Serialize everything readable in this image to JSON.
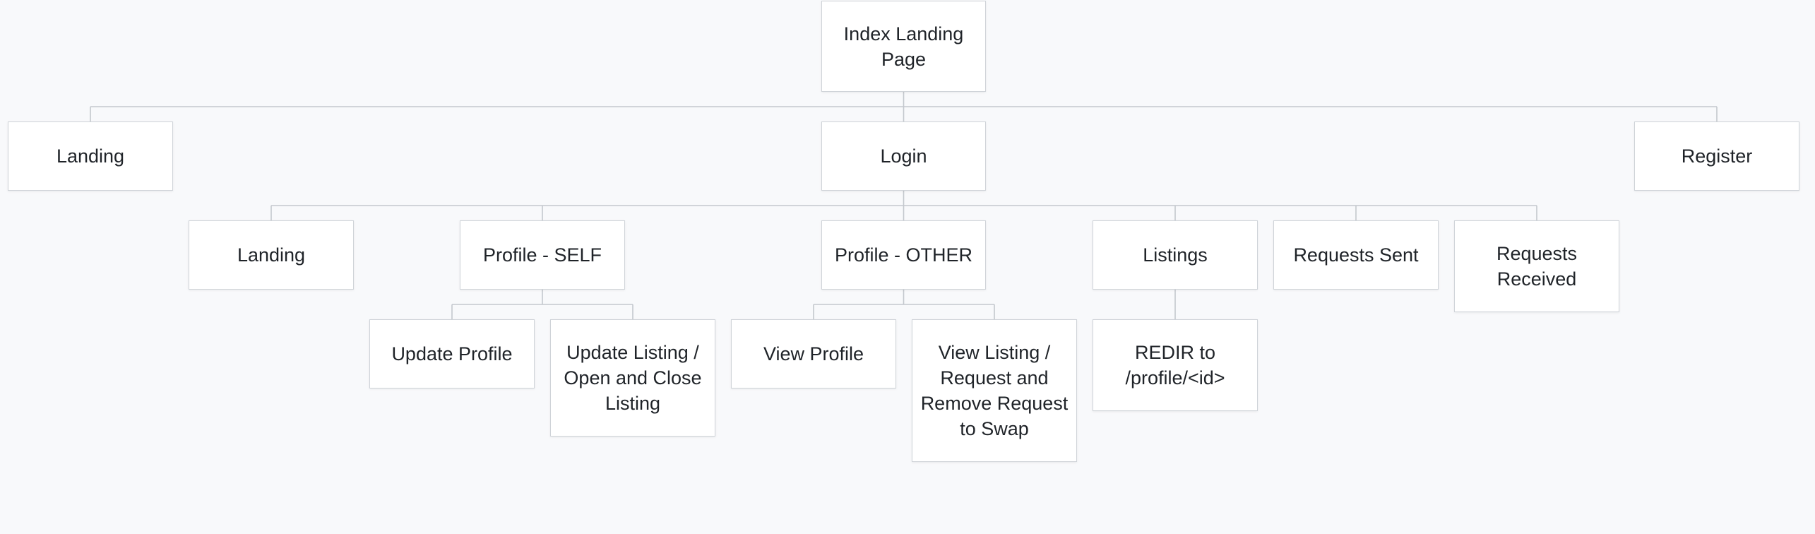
{
  "diagram": {
    "nodes": {
      "index": "Index Landing\nPage",
      "landing_top": "Landing",
      "login": "Login",
      "register": "Register",
      "landing_sub": "Landing",
      "profile_self": "Profile - SELF",
      "profile_other": "Profile - OTHER",
      "listings": "Listings",
      "requests_sent": "Requests Sent",
      "requests_received": "Requests\nReceived",
      "update_profile": "Update Profile",
      "update_listing": "Update Listing  /\nOpen and Close\nListing",
      "view_profile": "View Profile",
      "view_listing": "View Listing /\nRequest and\nRemove Request\nto Swap",
      "redir": "REDIR to\n/profile/<id>"
    },
    "edges": [
      [
        "index",
        "landing_top"
      ],
      [
        "index",
        "login"
      ],
      [
        "index",
        "register"
      ],
      [
        "login",
        "landing_sub"
      ],
      [
        "login",
        "profile_self"
      ],
      [
        "login",
        "profile_other"
      ],
      [
        "login",
        "listings"
      ],
      [
        "login",
        "requests_sent"
      ],
      [
        "login",
        "requests_received"
      ],
      [
        "profile_self",
        "update_profile"
      ],
      [
        "profile_self",
        "update_listing"
      ],
      [
        "profile_other",
        "view_profile"
      ],
      [
        "profile_other",
        "view_listing"
      ],
      [
        "listings",
        "redir"
      ]
    ]
  }
}
